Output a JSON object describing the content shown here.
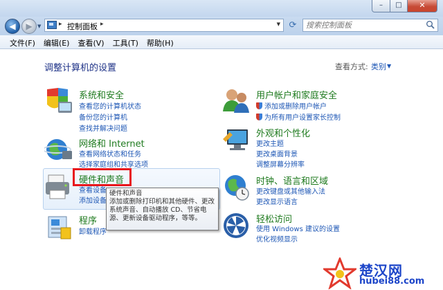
{
  "window": {
    "caption": {
      "minimize": "–",
      "maximize": "□",
      "close": "✕"
    }
  },
  "nav": {
    "back_glyph": "◀",
    "forward_glyph": "▶",
    "address_path": "控制面板",
    "search_placeholder": "搜索控制面板"
  },
  "menu": [
    "文件(F)",
    "编辑(E)",
    "查看(V)",
    "工具(T)",
    "帮助(H)"
  ],
  "main": {
    "heading": "调整计算机的设置",
    "view_by_label": "查看方式:",
    "view_by_value": "类别"
  },
  "categories": [
    {
      "title": "系统和安全",
      "links": [
        "查看您的计算机状态",
        "备份您的计算机",
        "查找并解决问题"
      ]
    },
    {
      "title": "网络和 Internet",
      "links": [
        "查看网络状态和任务",
        "选择家庭组和共享选项"
      ]
    },
    {
      "title": "硬件和声音",
      "links": [
        "查看设备",
        "添加设备"
      ]
    },
    {
      "title": "程序",
      "links": [
        "卸载程序"
      ]
    },
    {
      "title": "用户帐户和家庭安全",
      "links": [
        "添加或删除用户帐户",
        "为所有用户设置家长控制"
      ]
    },
    {
      "title": "外观和个性化",
      "links": [
        "更改主题",
        "更改桌面背景",
        "调整屏幕分辨率"
      ]
    },
    {
      "title": "时钟、语言和区域",
      "links": [
        "更改键盘或其他输入法",
        "更改显示语言"
      ]
    },
    {
      "title": "轻松访问",
      "links": [
        "使用 Windows 建议的设置",
        "优化视频显示"
      ]
    }
  ],
  "tooltip": {
    "title": "硬件和声音",
    "lines": [
      "添加或删除打印机和其他硬件、更改",
      "系统声音、自动播放 CD、节省电",
      "源、更新设备驱动程序，等等。"
    ]
  },
  "watermark": {
    "title": "楚汉网",
    "url": "hubei88.com"
  },
  "colors": {
    "link": "#1e57b5",
    "category_title": "#1e7a1e",
    "highlight": "#e8161c",
    "heading": "#1e3287"
  }
}
